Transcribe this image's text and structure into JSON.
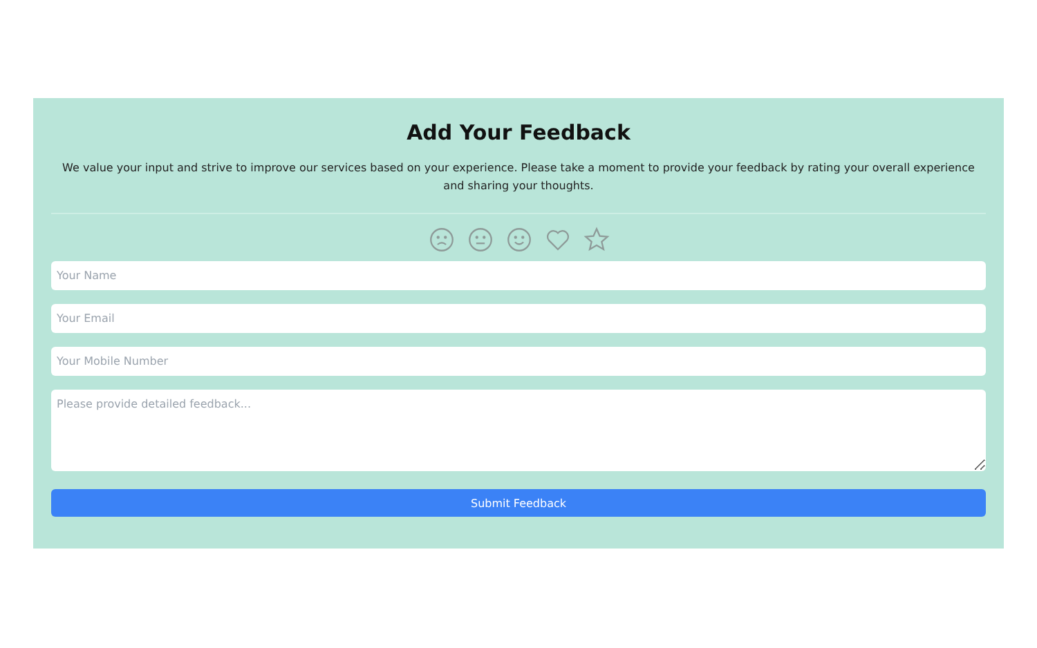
{
  "form": {
    "title": "Add Your Feedback",
    "description": "We value your input and strive to improve our services based on your experience. Please take a moment to provide your feedback by rating your overall experience and sharing your thoughts.",
    "ratings": [
      {
        "kind": "sad",
        "selected": false
      },
      {
        "kind": "neutral",
        "selected": false
      },
      {
        "kind": "happy",
        "selected": false
      },
      {
        "kind": "heart",
        "selected": false
      },
      {
        "kind": "star",
        "selected": false
      }
    ],
    "fields": [
      {
        "kind": "input",
        "placeholder": "Your Name"
      },
      {
        "kind": "input",
        "placeholder": "Your Email"
      },
      {
        "kind": "input",
        "placeholder": "Your Mobile Number"
      },
      {
        "kind": "textarea",
        "placeholder": "Please provide detailed feedback..."
      }
    ],
    "submit": "Submit Feedback"
  }
}
